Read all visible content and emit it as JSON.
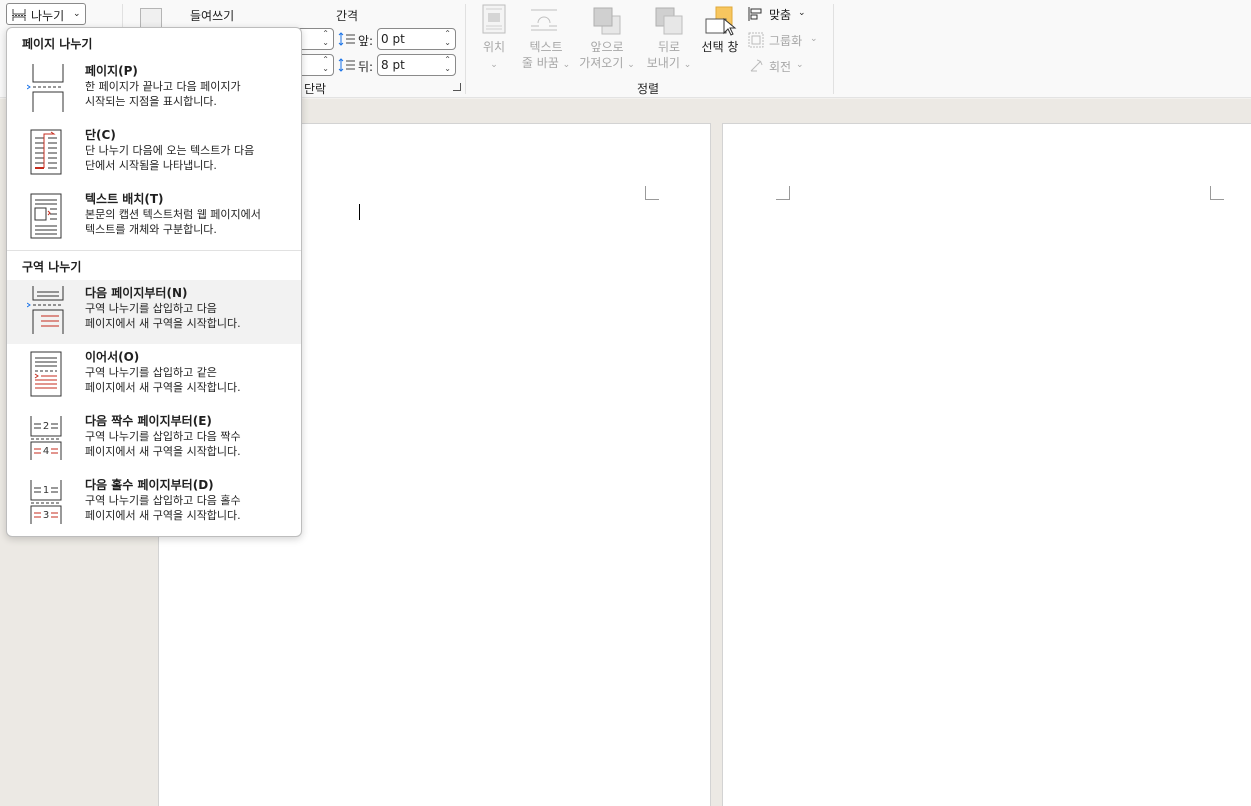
{
  "ribbon": {
    "breaks_button": "나누기",
    "indent_label": "들여쓰기",
    "spacing_label": "간격",
    "before_label": "앞:",
    "before_value": "0 pt",
    "after_label": "뒤:",
    "after_value": "8 pt",
    "paragraph_group": "단락",
    "position": "위치",
    "wrap_text_1": "텍스트",
    "wrap_text_2": "줄 바꿈",
    "bring_forward_1": "앞으로",
    "bring_forward_2": "가져오기",
    "send_backward_1": "뒤로",
    "send_backward_2": "보내기",
    "selection_pane": "선택 창",
    "align": "맞춤",
    "group": "그룹화",
    "rotate": "회전",
    "arrange_group": "정렬"
  },
  "menu": {
    "page_breaks_header": "페이지 나누기",
    "section_breaks_header": "구역 나누기",
    "page_breaks": [
      {
        "title": "페이지(P)",
        "desc": "한 페이지가 끝나고 다음 페이지가\n시작되는 지점을 표시합니다."
      },
      {
        "title": "단(C)",
        "desc": "단 나누기 다음에 오는 텍스트가 다음\n단에서 시작됨을 나타냅니다."
      },
      {
        "title": "텍스트 배치(T)",
        "desc": "본문의 캡션 텍스트처럼 웹 페이지에서\n텍스트를 개체와 구분합니다."
      }
    ],
    "section_breaks": [
      {
        "title": "다음 페이지부터(N)",
        "desc": "구역 나누기를 삽입하고 다음\n페이지에서 새 구역을 시작합니다."
      },
      {
        "title": "이어서(O)",
        "desc": "구역 나누기를 삽입하고 같은\n페이지에서 새 구역을 시작합니다."
      },
      {
        "title": "다음 짝수 페이지부터(E)",
        "desc": "구역 나누기를 삽입하고 다음 짝수\n페이지에서 새 구역을 시작합니다."
      },
      {
        "title": "다음 홀수 페이지부터(D)",
        "desc": "구역 나누기를 삽입하고 다음 홀수\n페이지에서 새 구역을 시작합니다."
      }
    ]
  },
  "colors": {
    "accent": "#c42b1c",
    "selection_pane": "#f7c65f"
  }
}
